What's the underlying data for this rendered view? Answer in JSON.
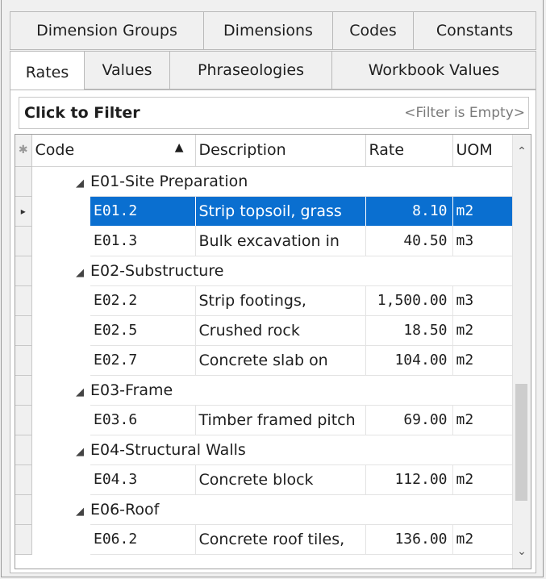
{
  "tabs_row1": [
    "Dimension Groups",
    "Dimensions",
    "Codes",
    "Constants"
  ],
  "tabs_row2": [
    "Rates",
    "Values",
    "Phraseologies",
    "Workbook Values"
  ],
  "active_tab": "Rates",
  "filter": {
    "label": "Click to Filter",
    "status": "<Filter is Empty>"
  },
  "columns": {
    "code": "Code",
    "description": "Description",
    "rate": "Rate",
    "uom": "UOM"
  },
  "row_indicator_glyph": "▸",
  "collapse_glyph": "◢",
  "sort_glyph": "▲",
  "header_star": "✱",
  "groups": [
    {
      "name": "E01-Site Preparation",
      "rows": [
        {
          "code": "E01.2",
          "description": "Strip topsoil, grass",
          "rate": "8.10",
          "uom": "m2",
          "selected": true
        },
        {
          "code": "E01.3",
          "description": "Bulk excavation in",
          "rate": "40.50",
          "uom": "m3"
        }
      ]
    },
    {
      "name": "E02-Substructure",
      "rows": [
        {
          "code": "E02.2",
          "description": "Strip footings,",
          "rate": "1,500.00",
          "uom": "m3"
        },
        {
          "code": "E02.5",
          "description": "Crushed rock",
          "rate": "18.50",
          "uom": "m2"
        },
        {
          "code": "E02.7",
          "description": "Concrete slab on",
          "rate": "104.00",
          "uom": "m2"
        }
      ]
    },
    {
      "name": "E03-Frame",
      "rows": [
        {
          "code": "E03.6",
          "description": "Timber framed pitch",
          "rate": "69.00",
          "uom": "m2"
        }
      ]
    },
    {
      "name": "E04-Structural Walls",
      "rows": [
        {
          "code": "E04.3",
          "description": "Concrete block",
          "rate": "112.00",
          "uom": "m2"
        }
      ]
    },
    {
      "name": "E06-Roof",
      "rows": [
        {
          "code": "E06.2",
          "description": "Concrete roof tiles,",
          "rate": "136.00",
          "uom": "m2"
        }
      ]
    }
  ],
  "colors": {
    "selection": "#0a6fd0",
    "window_bg": "#f0f0f0"
  }
}
